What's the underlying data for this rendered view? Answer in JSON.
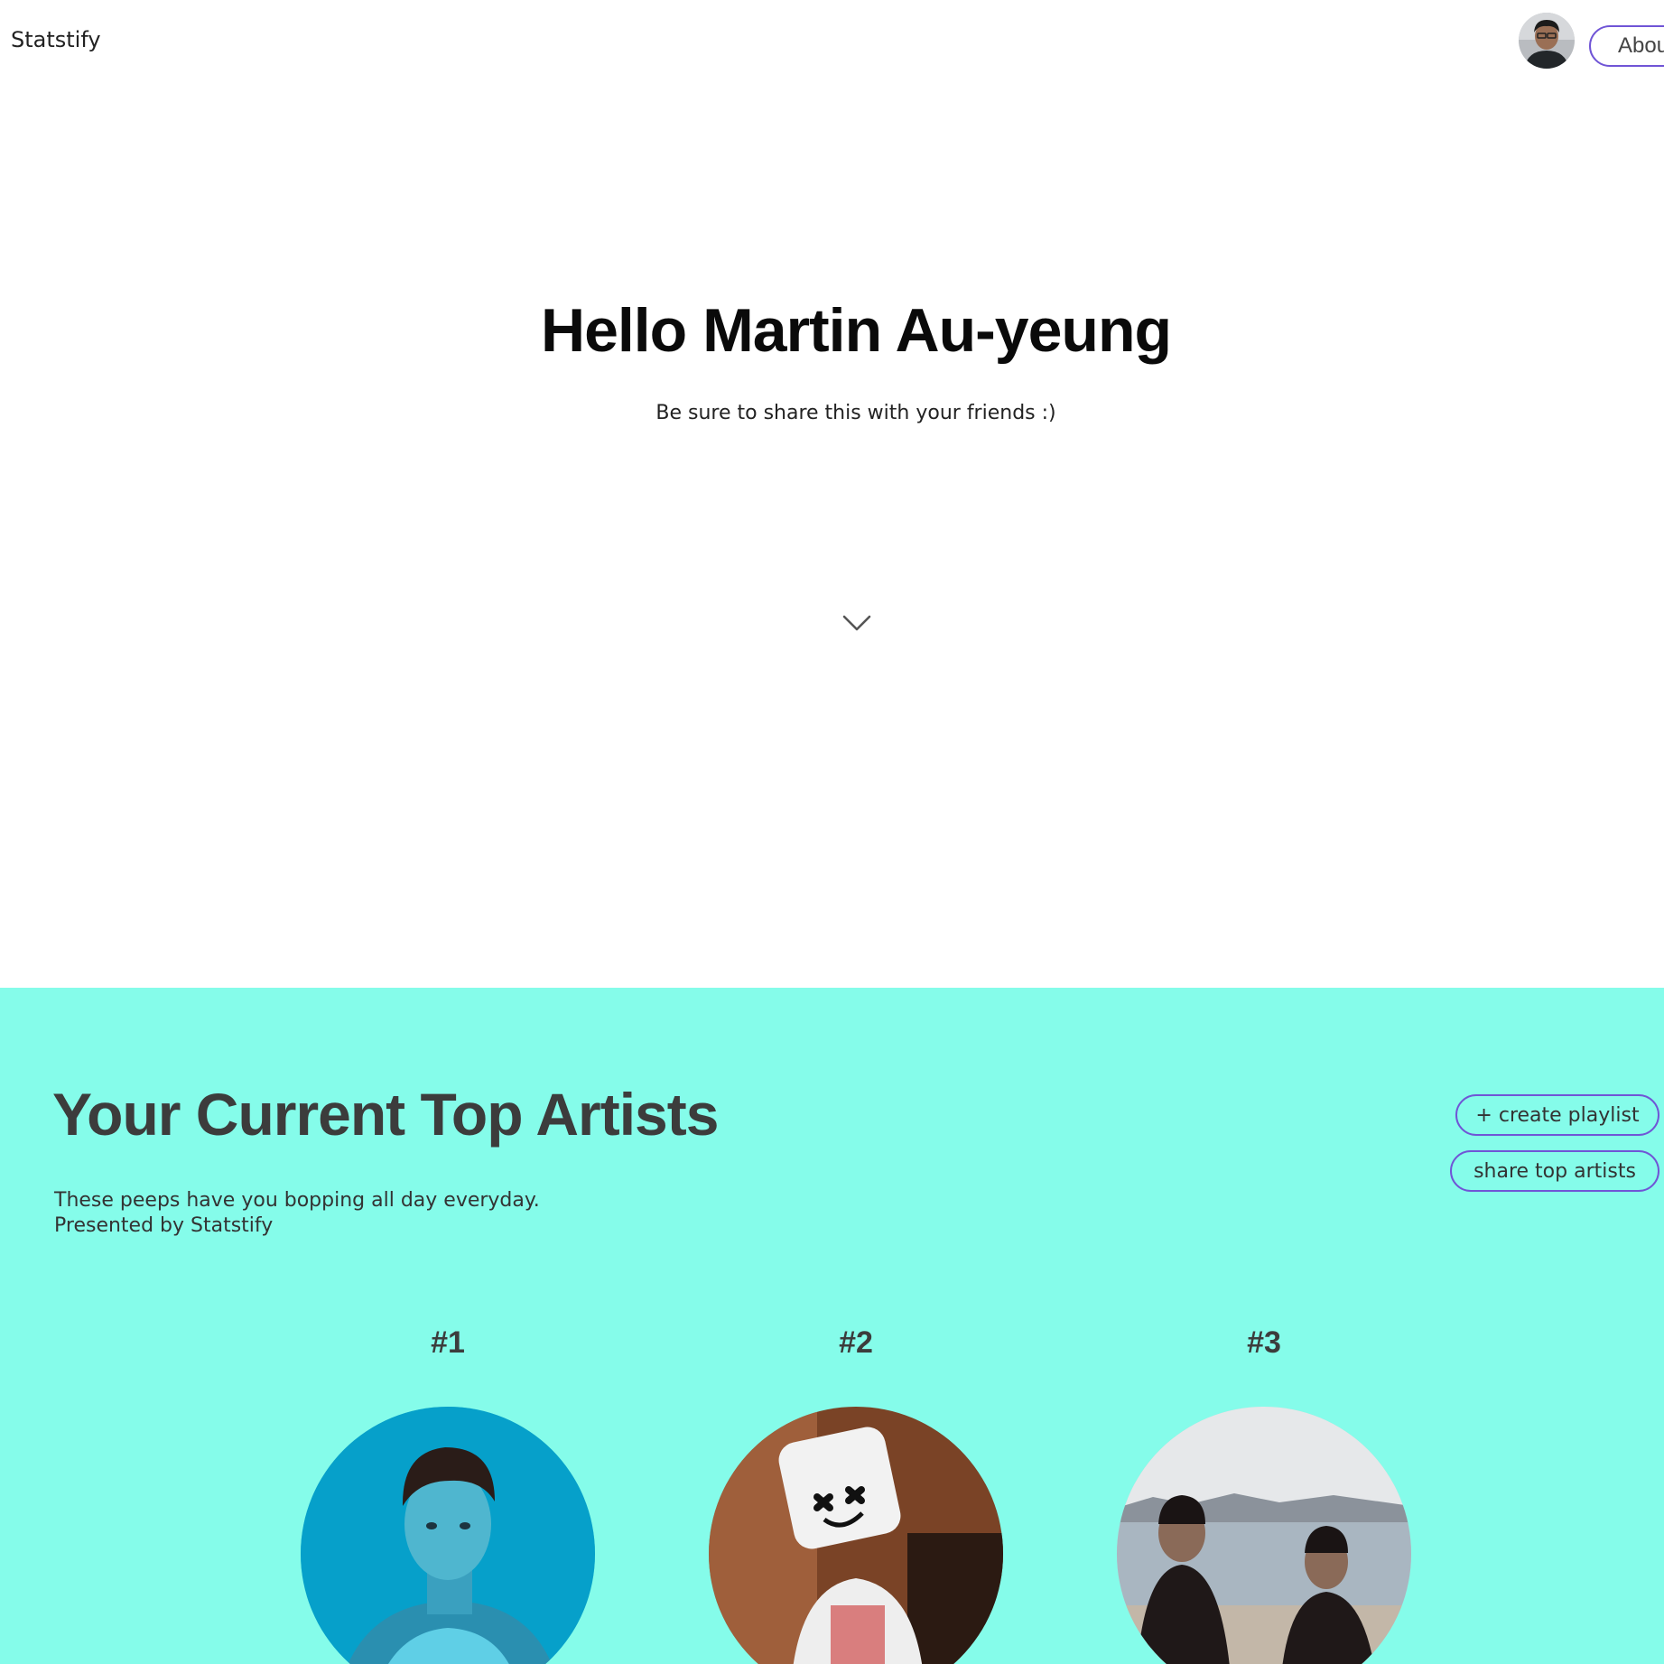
{
  "header": {
    "brand": "Statstify",
    "about_label": "About"
  },
  "hero": {
    "title": "Hello Martin Au-yeung",
    "subtitle": "Be sure to share this with your friends :)"
  },
  "top_artists": {
    "title": "Your Current Top Artists",
    "description_line1": "These peeps have you bopping all day everyday.",
    "description_line2": "Presented by Statstify",
    "create_playlist_label": "+ create playlist",
    "share_label": "share top artists",
    "background_color": "#85fcea",
    "accent_color": "#7055d6",
    "ranks": [
      "#1",
      "#2",
      "#3"
    ]
  }
}
